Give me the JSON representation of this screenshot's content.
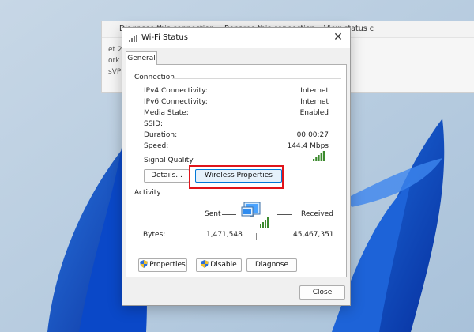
{
  "background_window": {
    "toolbar": [
      "Diagnose this connection",
      "Rename this connection",
      "View status c"
    ],
    "fragments": [
      "et 2",
      "ork c",
      "sVP"
    ]
  },
  "dialog": {
    "title": "Wi-Fi Status",
    "tab": "General",
    "connection": {
      "heading": "Connection",
      "rows": [
        {
          "label": "IPv4 Connectivity:",
          "value": "Internet"
        },
        {
          "label": "IPv6 Connectivity:",
          "value": "Internet"
        },
        {
          "label": "Media State:",
          "value": "Enabled"
        },
        {
          "label": "SSID:",
          "value": ""
        },
        {
          "label": "Duration:",
          "value": "00:00:27"
        },
        {
          "label": "Speed:",
          "value": "144.4 Mbps"
        }
      ],
      "signal_label": "Signal Quality:",
      "signal_bars_lit": 5,
      "signal_bars_total": 5,
      "details_button": "Details...",
      "wireless_button": "Wireless Properties"
    },
    "activity": {
      "heading": "Activity",
      "sent_label": "Sent",
      "received_label": "Received",
      "bytes_label": "Bytes:",
      "bytes_sent": "1,471,548",
      "bytes_received": "45,467,351",
      "properties_button": "Properties",
      "disable_button": "Disable",
      "diagnose_button": "Diagnose"
    },
    "close_button": "Close"
  },
  "colors": {
    "highlight": "#e0141a",
    "accent": "#0078d7",
    "signal": "#3c8a2e"
  }
}
